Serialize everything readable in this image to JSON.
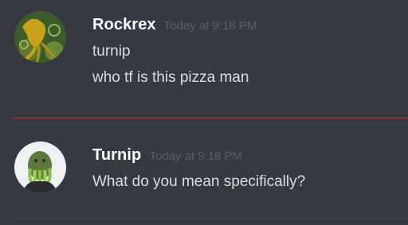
{
  "messages": [
    {
      "username": "Rockrex",
      "timestamp": "Today at 9:18 PM",
      "lines": [
        "turnip",
        "who tf is this pizza man"
      ],
      "avatar_icon": "squid-avatar"
    },
    {
      "username": "Turnip",
      "timestamp": "Today at 9:18 PM",
      "lines": [
        "What do you mean specifically?"
      ],
      "avatar_icon": "tentacle-face-avatar"
    }
  ],
  "colors": {
    "background": "#36393f",
    "username": "#ffffff",
    "timestamp": "#5a5e66",
    "message_text": "#dcddde",
    "new_messages_divider": "#8a3e43"
  }
}
